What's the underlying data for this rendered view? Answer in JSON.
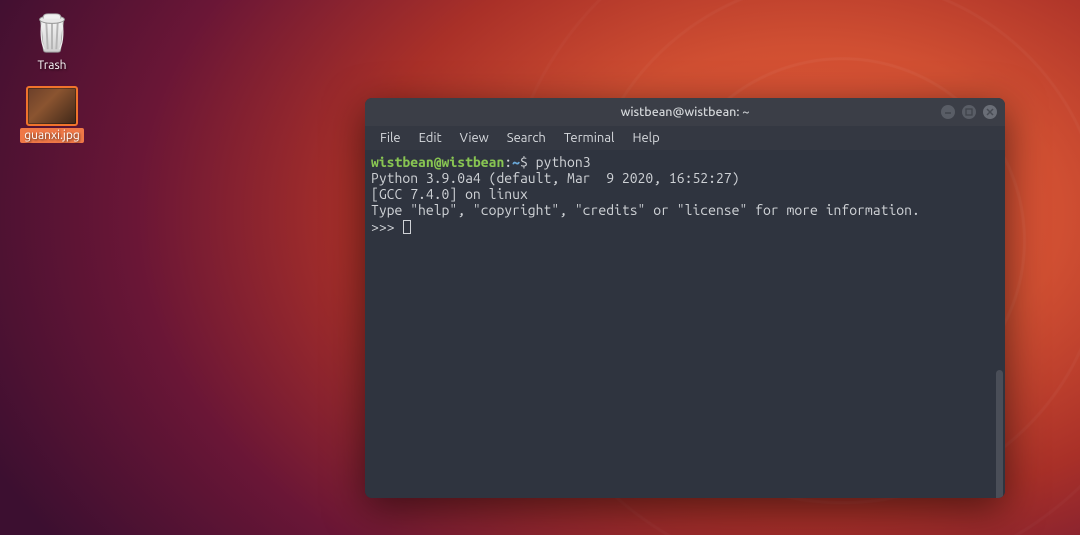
{
  "desktop": {
    "icons": [
      {
        "name": "trash",
        "label": "Trash"
      },
      {
        "name": "guanxi",
        "label": "guanxi.jpg"
      }
    ]
  },
  "terminal": {
    "title": "wistbean@wistbean: ~",
    "menu": [
      "File",
      "Edit",
      "View",
      "Search",
      "Terminal",
      "Help"
    ],
    "prompt": {
      "userhost": "wistbean@wistbean",
      "colon": ":",
      "path": "~",
      "dollar": "$",
      "command": "python3"
    },
    "lines": [
      "Python 3.9.0a4 (default, Mar  9 2020, 16:52:27)",
      "[GCC 7.4.0] on linux",
      "Type \"help\", \"copyright\", \"credits\" or \"license\" for more information."
    ],
    "repl_prompt": ">>> ",
    "win_buttons": {
      "minimize": "minimize",
      "maximize": "maximize",
      "close": "close"
    }
  }
}
